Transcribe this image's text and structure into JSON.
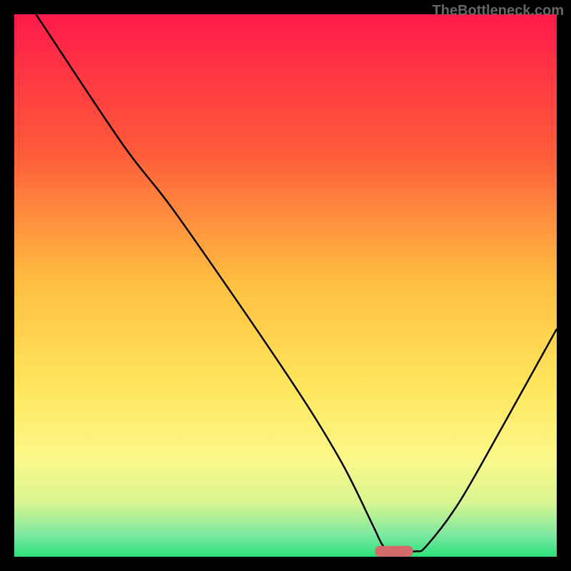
{
  "watermark": "TheBottleneck.com",
  "chart_data": {
    "type": "line",
    "title": "",
    "xlabel": "",
    "ylabel": "",
    "xlim": [
      0,
      100
    ],
    "ylim": [
      0,
      100
    ],
    "background": {
      "type": "vertical-gradient",
      "stops": [
        {
          "offset": 0,
          "color": "#ff1a4a"
        },
        {
          "offset": 25,
          "color": "#ff5a3a"
        },
        {
          "offset": 50,
          "color": "#ffc040"
        },
        {
          "offset": 70,
          "color": "#ffe860"
        },
        {
          "offset": 82,
          "color": "#fbf88a"
        },
        {
          "offset": 90,
          "color": "#d8f590"
        },
        {
          "offset": 96,
          "color": "#7de8a0"
        },
        {
          "offset": 100,
          "color": "#2be07a"
        }
      ]
    },
    "curve": {
      "description": "V-shaped bottleneck curve, minimum near x≈70",
      "points": [
        {
          "x": 4,
          "y": 100
        },
        {
          "x": 20,
          "y": 76
        },
        {
          "x": 30,
          "y": 63
        },
        {
          "x": 50,
          "y": 34
        },
        {
          "x": 60,
          "y": 18
        },
        {
          "x": 66,
          "y": 6
        },
        {
          "x": 68,
          "y": 2
        },
        {
          "x": 70,
          "y": 1
        },
        {
          "x": 74,
          "y": 1
        },
        {
          "x": 76,
          "y": 2
        },
        {
          "x": 82,
          "y": 10
        },
        {
          "x": 90,
          "y": 24
        },
        {
          "x": 100,
          "y": 42
        }
      ]
    },
    "marker": {
      "shape": "rounded-rect",
      "x": 70,
      "y": 1,
      "width": 7,
      "height": 2,
      "color": "#d46a6a"
    }
  }
}
